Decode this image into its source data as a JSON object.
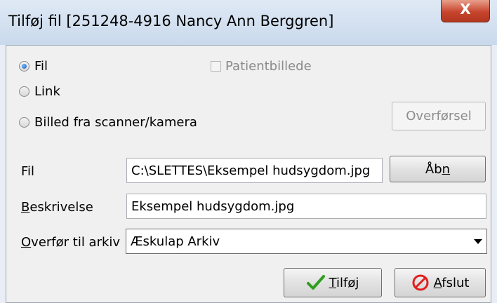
{
  "window": {
    "title": "Tilføj fil [251248-4916 Nancy Ann Berggren]",
    "close_glyph": "X"
  },
  "source": {
    "options": [
      {
        "label": "Fil",
        "checked": true
      },
      {
        "label": "Link",
        "checked": false
      },
      {
        "label": "Billed fra scanner/kamera",
        "checked": false
      }
    ],
    "patient_image_label": "Patientbillede",
    "patient_image_checked": false,
    "transfer_button": "Overførsel"
  },
  "form": {
    "file_label": "Fil",
    "file_value": "C:\\SLETTES\\Eksempel hudsygdom.jpg",
    "open_button_pre": "Åb",
    "open_button_ul": "n",
    "description_label_ul": "B",
    "description_label_rest": "eskrivelse",
    "description_value": "Eksempel hudsygdom.jpg",
    "archive_label_ul": "O",
    "archive_label_rest": "verfør til arkiv",
    "archive_value": "Æskulap Arkiv"
  },
  "actions": {
    "add_ul": "T",
    "add_rest": "ilføj",
    "close_ul": "A",
    "close_rest": "fslut"
  },
  "colors": {
    "check_icon": "#2f9e1f",
    "stop_icon": "#e02020"
  }
}
